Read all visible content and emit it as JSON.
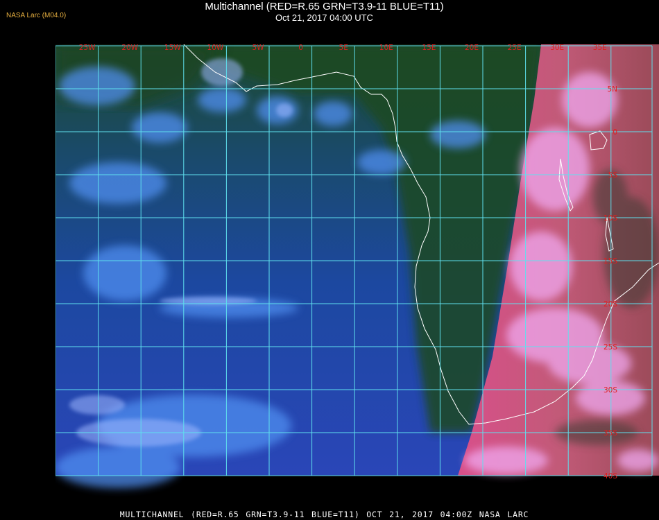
{
  "header": {
    "credit": "NASA Larc (M04.0)",
    "title": "Multichannel (RED=R.65 GRN=T3.9-11 BLUE=T11)",
    "subtitle": "Oct 21, 2017 04:00 UTC"
  },
  "footer": {
    "text": "MULTICHANNEL (RED=R.65 GRN=T3.9-11 BLUE=T11) OCT 21, 2017 04:00Z   NASA LARC"
  },
  "map": {
    "colors": {
      "grid": "#5fe0ee",
      "coast": "#ffffff",
      "label": "#e02020",
      "ocean": "#1a4a9a",
      "night_green": "#1c4420",
      "sunlit_land": "#c84f7c",
      "cloud_pink": "#e88ee0"
    },
    "lon_labels": [
      "25W",
      "20W",
      "15W",
      "10W",
      "5W",
      "0",
      "5E",
      "10E",
      "15E",
      "20E",
      "25E",
      "30E",
      "35E"
    ],
    "lat_labels": [
      "5N",
      "0",
      "5S",
      "10S",
      "15S",
      "20S",
      "25S",
      "30S",
      "35S",
      "40S"
    ]
  }
}
